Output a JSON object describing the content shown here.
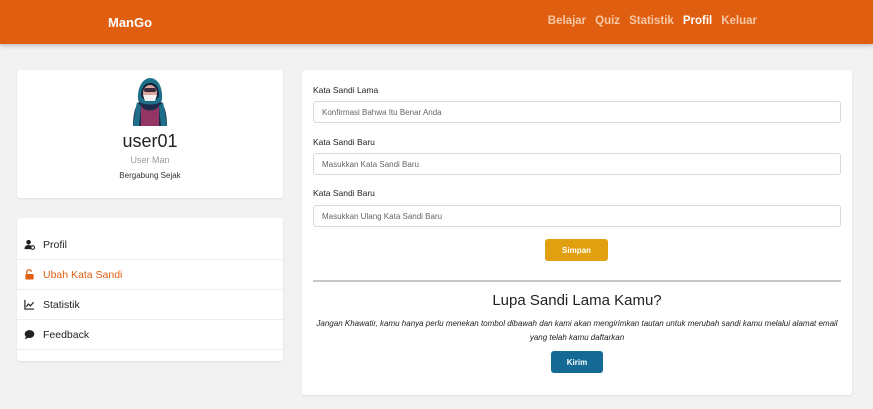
{
  "navbar": {
    "brand": "ManGo",
    "links": [
      {
        "label": "Belajar",
        "active": false
      },
      {
        "label": "Quiz",
        "active": false
      },
      {
        "label": "Statistik",
        "active": false
      },
      {
        "label": "Profil",
        "active": true
      },
      {
        "label": "Keluar",
        "active": false
      }
    ],
    "color": "#e05e10"
  },
  "profile": {
    "username": "user01",
    "role": "User Man",
    "joined": "Bergabung Sejak"
  },
  "menu": {
    "items": [
      {
        "label": "Profil",
        "icon": "user-gear-icon"
      },
      {
        "label": "Ubah Kata Sandi",
        "icon": "unlock-icon",
        "active": true
      },
      {
        "label": "Statistik",
        "icon": "chart-line-icon"
      },
      {
        "label": "Feedback",
        "icon": "comment-icon"
      }
    ]
  },
  "form": {
    "old_password": {
      "label": "Kata Sandi Lama",
      "placeholder": "Konfirmasi Bahwa Itu Benar Anda"
    },
    "new_password": {
      "label": "Kata Sandi Baru",
      "placeholder": "Masukkan Kata Sandi Baru"
    },
    "confirm_password": {
      "label": "Kata Sandi Baru",
      "placeholder": "Masukkan Ulang Kata Sandi Baru"
    },
    "save_label": "Simpan",
    "save_color": "#e0a00f"
  },
  "forgot": {
    "title": "Lupa Sandi Lama Kamu?",
    "text": "Jangan Khawatir, kamu hanya perlu menekan tombol dibawah dan kami akan mengirimkan tautan untuk merubah sandi kamu melalui alamat email yang telah kamu daftarkan",
    "send_label": "Kirim",
    "send_color": "#146a94"
  }
}
